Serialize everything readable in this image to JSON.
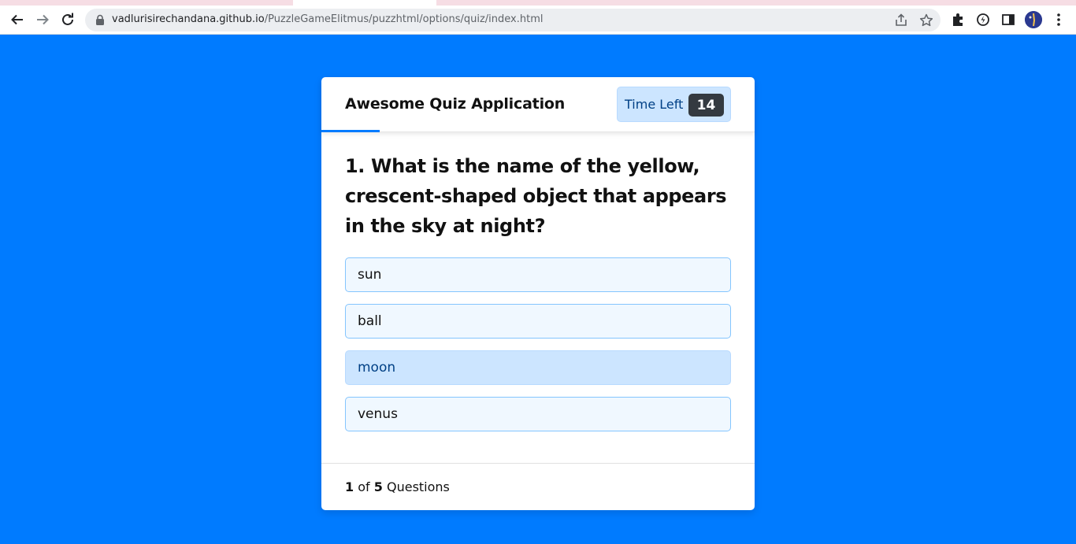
{
  "browser": {
    "url_host": "vadlurisirechandana.github.io",
    "url_path": "/PuzzleGameElitmus/puzzhtml/options/quiz/index.html",
    "icons": [
      "back-arrow-icon",
      "forward-arrow-icon",
      "reload-icon",
      "lock-icon",
      "share-icon",
      "star-icon",
      "extensions-icon",
      "performance-icon",
      "side-panel-icon",
      "avatar",
      "kebab-menu-icon"
    ]
  },
  "quiz": {
    "title": "Awesome Quiz Application",
    "timer_label": "Time Left",
    "timer_seconds": "14",
    "time_progress": 0.135,
    "question_number": "1.",
    "question_text": "What is the name of the yellow, crescent-shaped object that appears in the sky at night?",
    "options": [
      {
        "label": "sun"
      },
      {
        "label": "ball"
      },
      {
        "label": "moon"
      },
      {
        "label": "venus"
      }
    ],
    "footer": {
      "current": "1",
      "of_text": "of",
      "total": "5",
      "questions_text": "Questions"
    }
  },
  "colors": {
    "page_background": "#007bff",
    "timer_background": "#cce5ff",
    "timer_seconds_background": "#343a40",
    "option_background": "#f0f8ff",
    "option_border": "#84c5fe",
    "option_hover_background": "#cce5ff"
  }
}
